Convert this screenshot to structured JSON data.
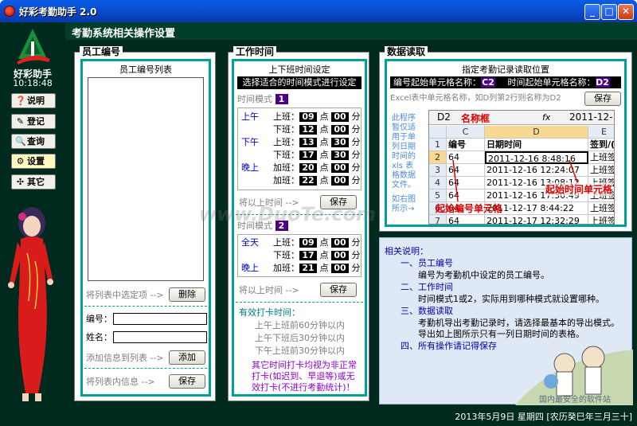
{
  "window": {
    "title": "好彩考勤助手 2.0",
    "minimize": "_",
    "maximize": "□",
    "close": "✕"
  },
  "sidebar": {
    "brand": "好彩助手",
    "clock": "10:18:48",
    "buttons": [
      {
        "icon": "❓",
        "label": "说明"
      },
      {
        "icon": "✎",
        "label": "登记"
      },
      {
        "icon": "🔍",
        "label": "查询"
      },
      {
        "icon": "⚙",
        "label": "设置"
      },
      {
        "icon": "✣",
        "label": "其它"
      }
    ]
  },
  "header": {
    "title": "考勤系统相关操作设置"
  },
  "employee": {
    "section_title": "员工编号",
    "list_title": "员工编号列表",
    "delete_hint": "将列表中选定项 -->",
    "delete_btn": "删除",
    "id_label": "编号：",
    "name_label": "姓名：",
    "add_hint": "添加信息到列表 -->",
    "add_btn": "添加",
    "save_hint": "将列表内信息 -->",
    "save_btn": "保存"
  },
  "worktime": {
    "section_title": "工作时间",
    "box_title": "上下班时间设定",
    "choose": "选择适合的时间模式进行设定",
    "mode1": {
      "label": "时间模式",
      "num": "1",
      "rows": [
        {
          "period": "上午",
          "type": "上班：",
          "h": "09",
          "m": "00"
        },
        {
          "period": "",
          "type": "下班：",
          "h": "12",
          "m": "00"
        },
        {
          "period": "下午",
          "type": "上班：",
          "h": "13",
          "m": "30"
        },
        {
          "period": "",
          "type": "下班：",
          "h": "17",
          "m": "30"
        },
        {
          "period": "晚上",
          "type": "加班：",
          "h": "20",
          "m": "00"
        },
        {
          "period": "",
          "type": "加班：",
          "h": "22",
          "m": "00"
        }
      ],
      "save_hint": "将以上时间 -->",
      "save_btn": "保存"
    },
    "mode2": {
      "label": "时间模式",
      "num": "2",
      "rows": [
        {
          "period": "全天",
          "type": "上班：",
          "h": "09",
          "m": "00"
        },
        {
          "period": "",
          "type": "下班：",
          "h": "17",
          "m": "00"
        },
        {
          "period": "晚上",
          "type": "加班：",
          "h": "21",
          "m": "00"
        }
      ],
      "save_hint": "将以上时间 -->",
      "save_btn": "保存"
    },
    "dian": "点",
    "fen": "分",
    "valid_title": "有效打卡时间：",
    "valid_rows": [
      "上午上班前60分钟以内",
      "上午下班后30分钟以内",
      "下午上班前30分钟以内"
    ],
    "warning": [
      "其它时间打卡均视为非正常",
      "打卡(如迟到、早退等)或无",
      "效打卡(不进行考勤统计)！"
    ]
  },
  "dataread": {
    "section_title": "数据读取",
    "box_title": "指定考勤记录读取位置",
    "id_cell_label": "编号起始单元格名称：",
    "id_cell": "C2",
    "dt_cell_label": "时间起始单元格名称：",
    "dt_cell": "D2",
    "hint": "Excel表中单元格名称，如D列第2行则名称为D2",
    "save_btn": "保存",
    "side_note": [
      "此程序",
      "暂仅适",
      "用于单",
      "列日期",
      "时间的",
      "xls 表",
      "格数据",
      "文件。"
    ],
    "side_note2": [
      "如右图",
      "所示→"
    ],
    "sheet": {
      "namebox": "D2",
      "namebox_label": "名称框",
      "fx": "fx",
      "formula": "2011-12-",
      "cols": [
        "C",
        "D",
        "E"
      ],
      "rows": [
        {
          "n": "1",
          "c": "编号",
          "d": "日期时间",
          "e": "签到/("
        },
        {
          "n": "2",
          "c": "64",
          "d": "2011-12-16  8:48:16",
          "e": "上班签"
        },
        {
          "n": "3",
          "c": "64",
          "d": "2011-12-16 12:24:07",
          "e": "上班签"
        },
        {
          "n": "4",
          "c": "64",
          "d": "2011-12-16 13:08:12",
          "e": "上班签"
        },
        {
          "n": "5",
          "c": "64",
          "d": "2011-12-16 17:30:49",
          "e": "上班签"
        },
        {
          "n": "6",
          "c": "64",
          "d": "2011-12-17  8:44:22",
          "e": "上班签"
        },
        {
          "n": "7",
          "c": "64",
          "d": "2011-12-17 12:32:29",
          "e": "上班签"
        }
      ],
      "annot_id": "起始编号单元格",
      "annot_dt": "起始时间单元格"
    }
  },
  "info": {
    "title": "相关说明：",
    "items": [
      {
        "head": "一、员工编号",
        "body": [
          "编号为考勤机中设定的员工编号。"
        ]
      },
      {
        "head": "二、工作时间",
        "body": [
          "时间模式1或2，实际用到哪种模式就设置哪种。"
        ]
      },
      {
        "head": "三、数据读取",
        "body": [
          "考勤机导出考勤记录时，请选择最基本的导出模式。",
          "导出如上图所示只有一列日期时间的表格。"
        ]
      },
      {
        "head": "四、所有操作请记得保存",
        "body": []
      }
    ],
    "footer": "国内最安全的软件站"
  },
  "status": {
    "text": "2013年5月9日  星期四 [农历癸巳年三月三十]"
  },
  "watermark": "www.DuoTe.com",
  "colors": {
    "teal": "#00a19a",
    "dark_green": "#002a1e",
    "mode": "#4b0082"
  }
}
